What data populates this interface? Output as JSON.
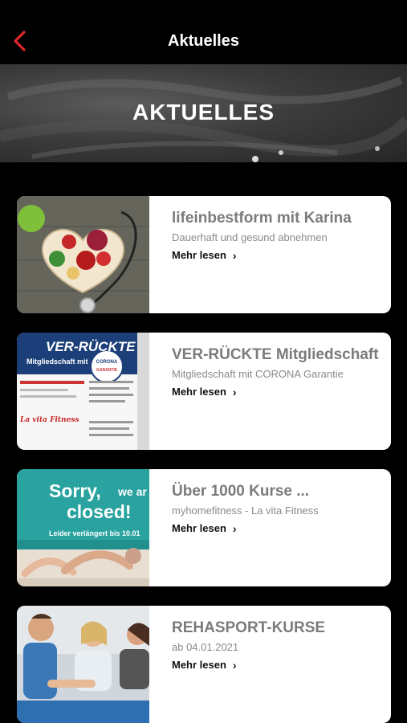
{
  "header": {
    "title": "Aktuelles",
    "back_icon": "chevron-left-icon",
    "accent": "#e0262b"
  },
  "hero": {
    "title": "AKTUELLES"
  },
  "cards": [
    {
      "title": "lifeinbestform mit Karina",
      "subtitle": "Dauerhaft und gesund abnehmen",
      "more": "Mehr lesen",
      "image": "healthy-food-heart-image"
    },
    {
      "title": "VER-RÜCKTE Mitgliedschaft",
      "subtitle": "Mitgliedschaft mit CORONA Garantie",
      "more": "Mehr lesen",
      "image": "membership-flyer-image",
      "image_text": {
        "headline": "VER-RÜCKTE",
        "line": "Mitgliedschaft mit",
        "badge": "CORONA",
        "badge2": "GARANTIE",
        "logo": "La vita Fitness"
      }
    },
    {
      "title": "Über 1000 Kurse ...",
      "subtitle": "myhomefitness - La vita Fitness",
      "more": "Mehr lesen",
      "image": "sorry-closed-image",
      "image_text": {
        "line1": "Sorry,",
        "line1b": "we ar",
        "line2": "closed!",
        "line3": "Leider verlängert bis 10.01"
      }
    },
    {
      "title": "REHASPORT-KURSE",
      "subtitle": "ab 04.01.2021",
      "more": "Mehr lesen",
      "image": "rehasport-group-image"
    }
  ]
}
